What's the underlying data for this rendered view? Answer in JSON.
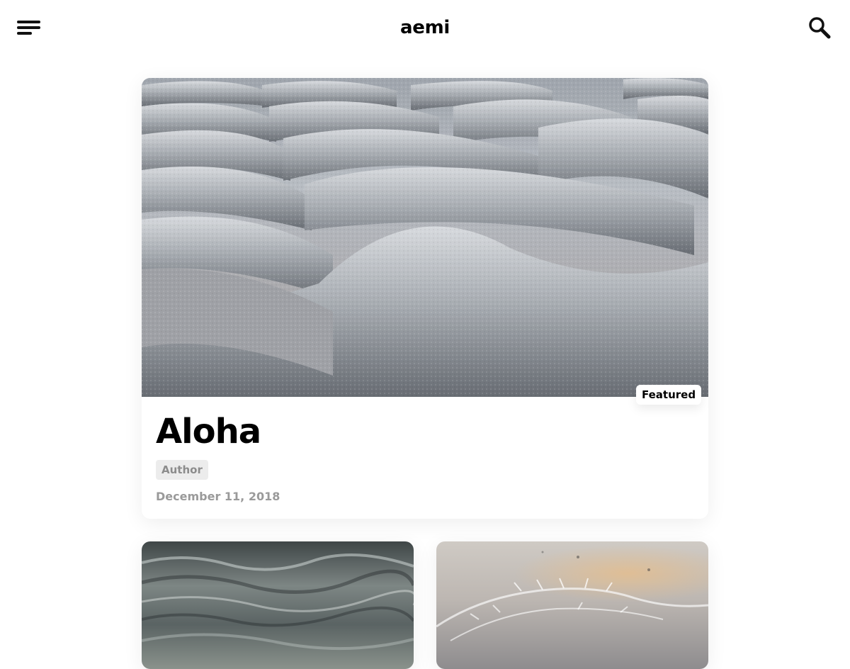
{
  "header": {
    "site_title": "aemi",
    "menu_icon": "hamburger-menu-icon",
    "search_icon": "search-icon"
  },
  "featured_post": {
    "badge": "Featured",
    "title": "Aloha",
    "author": "Author",
    "date": "December 11, 2018",
    "image": "frosted-roof-tiles-photo"
  },
  "posts": [
    {
      "image": "water-surface-photo"
    },
    {
      "image": "frost-pattern-photo"
    }
  ]
}
